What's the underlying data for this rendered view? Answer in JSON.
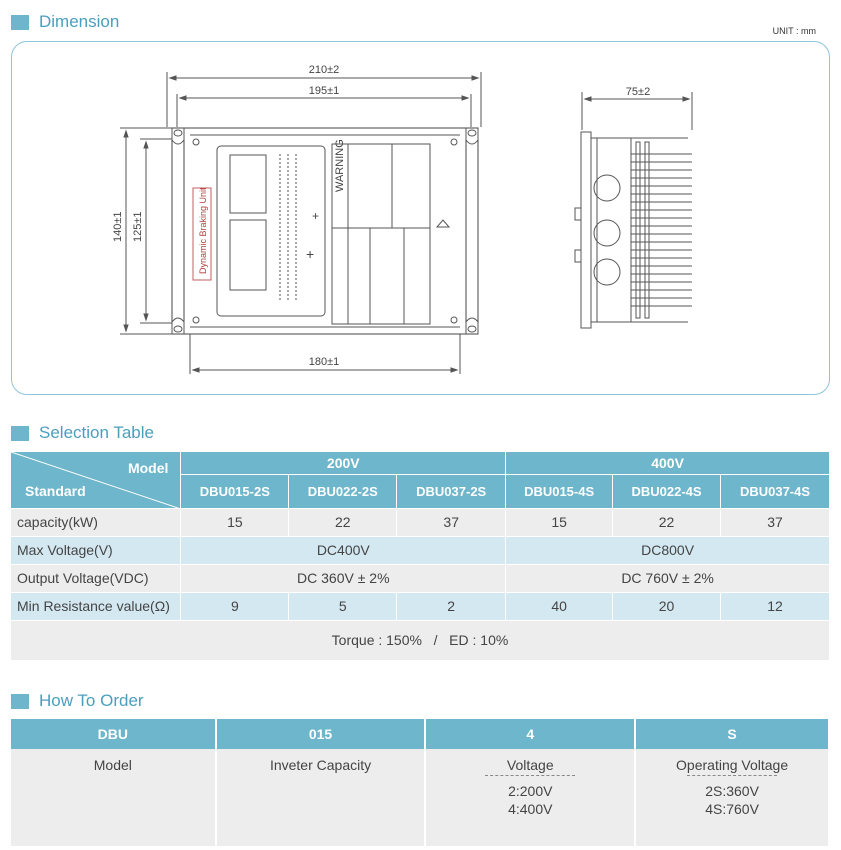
{
  "dimension": {
    "title": "Dimension",
    "unit": "UNIT : mm",
    "labels": {
      "w210": "210±2",
      "w195": "195±1",
      "w180": "180±1",
      "h140": "140±1",
      "h125": "125±1",
      "d75": "75±2",
      "unit_name": "Dynamic Braking Unit",
      "warning": "WARNING"
    }
  },
  "selection": {
    "title": "Selection Table",
    "corner_model": "Model",
    "corner_standard": "Standard",
    "groups": [
      "200V",
      "400V"
    ],
    "models": [
      "DBU015-2S",
      "DBU022-2S",
      "DBU037-2S",
      "DBU015-4S",
      "DBU022-4S",
      "DBU037-4S"
    ],
    "capacity": {
      "label": "capacity(kW)",
      "values": [
        "15",
        "22",
        "37",
        "15",
        "22",
        "37"
      ]
    },
    "max_voltage": {
      "label": "Max Voltage(V)",
      "values": [
        "DC400V",
        "DC800V"
      ]
    },
    "output_voltage": {
      "label": "Output Voltage(VDC)",
      "values": [
        "DC 360V ± 2%",
        "DC 760V ± 2%"
      ]
    },
    "min_resistance": {
      "label": "Min Resistance value(Ω)",
      "values": [
        "9",
        "5",
        "2",
        "40",
        "20",
        "12"
      ]
    },
    "torque": "Torque : 150%   /   ED : 10%"
  },
  "order": {
    "title": "How To Order",
    "codes": [
      "DBU",
      "015",
      "4",
      "S"
    ],
    "descriptions": [
      "Model",
      "Inveter Capacity",
      "Voltage",
      "Operating Voltage"
    ],
    "voltage_options": [
      "2:200V",
      "4:400V"
    ],
    "operating_options": [
      "2S:360V",
      "4S:760V"
    ]
  }
}
